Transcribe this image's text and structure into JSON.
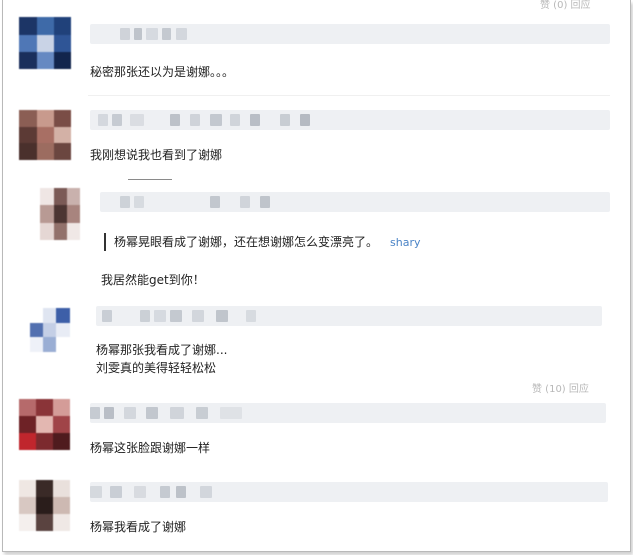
{
  "header": {
    "meta_top": "赞 (0)  回应"
  },
  "comments": [
    {
      "text": "秘密那张还以为是谢娜。。。"
    },
    {
      "text": "我刚想说我也看到了谢娜"
    },
    {
      "reply": {
        "quote_text": "杨幂晃眼看成了谢娜，还在想谢娜怎么变漂亮了。",
        "quote_author": "shary",
        "text": "我居然能get到你！"
      }
    },
    {
      "text_lines": [
        "杨幂那张我看成了谢娜...",
        "刘雯真的美得轻轻松松"
      ],
      "meta": "赞 (10)  回应"
    },
    {
      "text": "杨幂这张脸跟谢娜一样"
    },
    {
      "text": "杨幂我看成了谢娜"
    }
  ]
}
